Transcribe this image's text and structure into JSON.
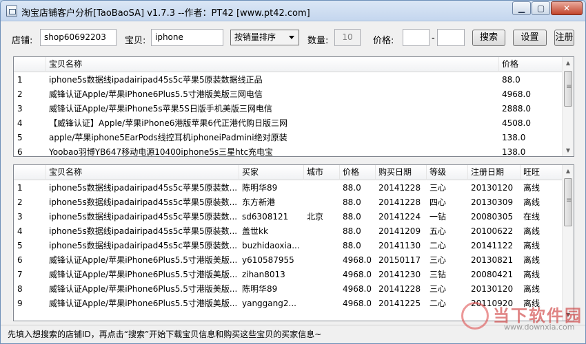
{
  "window": {
    "title": "淘宝店铺客户分析[TaoBaoSA] v1.7.3 --作者：PT42 [www.pt42.com]",
    "minimize": "▁",
    "maximize": "▢",
    "close": "✕"
  },
  "toolbar": {
    "shop_label": "店铺:",
    "shop_value": "shop60692203",
    "item_label": "宝贝:",
    "item_value": "iphone",
    "sort_selected": "按销量排序",
    "count_label": "数量:",
    "count_value": "10",
    "price_label": "价格:",
    "price_min": "",
    "price_dash": "-",
    "price_max": "",
    "search_button": "搜索",
    "settings_button": "设置",
    "register_button": "注册"
  },
  "items_table": {
    "columns": [
      "",
      "宝贝名称",
      "价格"
    ],
    "rows": [
      [
        "1",
        "iphone5s数据线ipadairipad45s5c苹果5原装数据线正品",
        "88.0"
      ],
      [
        "2",
        "威锋认证Apple/苹果iPhone6Plus5.5寸港版美版三网电信",
        "4968.0"
      ],
      [
        "3",
        "威锋认证Apple/苹果iPhone5s苹果5S日版手机美版三网电信",
        "2888.0"
      ],
      [
        "4",
        "【威锋认证】Apple/苹果iPhone6港版苹果6代正港代购日版三网",
        "4508.0"
      ],
      [
        "5",
        "apple/苹果iphone5EarPods线控耳机iphoneiPadmini绝对原装",
        "138.0"
      ],
      [
        "6",
        "Yoobao羽博YB647移动电源10400iphone5s三星htc充电宝",
        "138.0"
      ]
    ]
  },
  "buyers_table": {
    "columns": [
      "",
      "宝贝名称",
      "买家",
      "城市",
      "价格",
      "购买日期",
      "等级",
      "注册日期",
      "旺旺"
    ],
    "rows": [
      [
        "1",
        "iphone5s数据线ipadairipad45s5c苹果5原装数...",
        "陈明华89",
        "",
        "88.0",
        "20141228",
        "三心",
        "20130120",
        "离线"
      ],
      [
        "2",
        "iphone5s数据线ipadairipad45s5c苹果5原装数...",
        "东方新港",
        "",
        "88.0",
        "20141228",
        "四心",
        "20130309",
        "离线"
      ],
      [
        "3",
        "iphone5s数据线ipadairipad45s5c苹果5原装数...",
        "sd6308121",
        "北京",
        "88.0",
        "20141224",
        "一钻",
        "20080305",
        "在线"
      ],
      [
        "4",
        "iphone5s数据线ipadairipad45s5c苹果5原装数...",
        "盖世kk",
        "",
        "88.0",
        "20141209",
        "五心",
        "20100622",
        "离线"
      ],
      [
        "5",
        "iphone5s数据线ipadairipad45s5c苹果5原装数...",
        "buzhidaoxia...",
        "",
        "88.0",
        "20141130",
        "二心",
        "20141122",
        "离线"
      ],
      [
        "6",
        "威锋认证Apple/苹果iPhone6Plus5.5寸港版美版...",
        "y610587955",
        "",
        "4968.0",
        "20150117",
        "三心",
        "20130821",
        "离线"
      ],
      [
        "7",
        "威锋认证Apple/苹果iPhone6Plus5.5寸港版美版...",
        "zihan8013",
        "",
        "4968.0",
        "20141230",
        "三钻",
        "20080421",
        "离线"
      ],
      [
        "8",
        "威锋认证Apple/苹果iPhone6Plus5.5寸港版美版...",
        "陈明华89",
        "",
        "4968.0",
        "20141228",
        "三心",
        "20130120",
        "离线"
      ],
      [
        "9",
        "威锋认证Apple/苹果iPhone6Plus5.5寸港版美版...",
        "yanggang2...",
        "",
        "4968.0",
        "20141225",
        "二心",
        "20110920",
        "离线"
      ]
    ]
  },
  "status": {
    "text": "先填入想搜索的店铺ID，再点击“搜索”开始下载宝贝信息和购买这些宝贝的买家信息~"
  },
  "watermark": {
    "text": "当下软件园",
    "sub": "www.downxia.com"
  },
  "icons": {
    "app": "app-icon",
    "dropdown": "chevron-down-icon",
    "scroll_up": "scroll-up-icon",
    "scroll_down": "scroll-down-icon"
  }
}
